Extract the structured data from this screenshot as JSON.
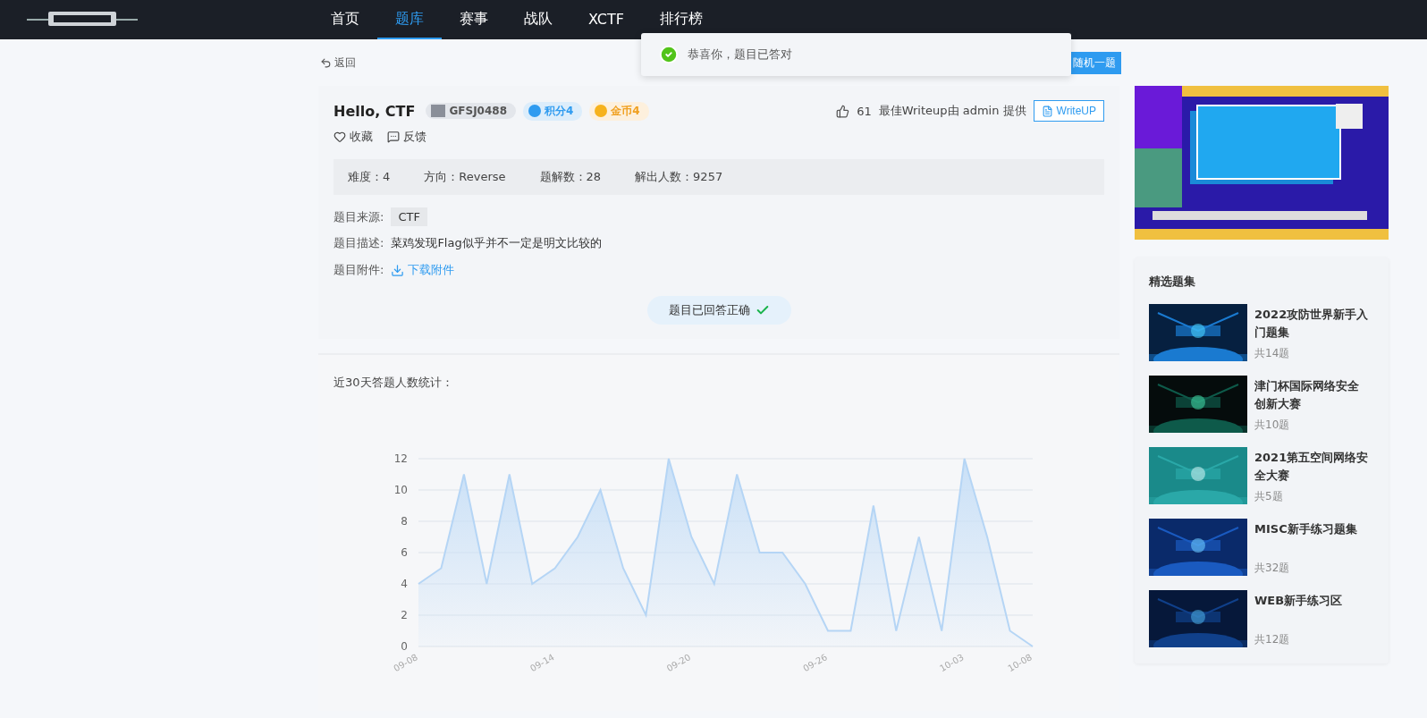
{
  "nav": {
    "items": [
      {
        "label": "首页",
        "selected": false
      },
      {
        "label": "题库",
        "selected": true
      },
      {
        "label": "赛事",
        "selected": false
      },
      {
        "label": "战队",
        "selected": false
      },
      {
        "label": "XCTF",
        "selected": false
      },
      {
        "label": "排行榜",
        "selected": false
      }
    ]
  },
  "toast": {
    "message": "恭喜你，题目已答对"
  },
  "back": "返回",
  "random_button": "随机一题",
  "challenge": {
    "title": "Hello, CTF",
    "code": "GFSJ0488",
    "score": "积分4",
    "coins": "金币4",
    "likes": "61",
    "writeup_note": "最佳Writeup由 admin 提供",
    "writeup_button": "WriteUP",
    "favorite": "收藏",
    "feedback": "反馈",
    "stats": [
      {
        "label": "难度：",
        "value": "4"
      },
      {
        "label": "方向：",
        "value": "Reverse"
      },
      {
        "label": "题解数：",
        "value": "28"
      },
      {
        "label": "解出人数：",
        "value": "9257"
      }
    ],
    "source_label": "题目来源:",
    "source": "CTF",
    "desc_label": "题目描述:",
    "desc": "菜鸡发现Flag似乎并不一定是明文比较的",
    "attach_label": "题目附件:",
    "attach": "下载附件",
    "status": "题目已回答正确"
  },
  "stats_panel": {
    "title": "近30天答题人数统计：",
    "chart_data": {
      "type": "area",
      "categories": [
        "09-08",
        null,
        null,
        null,
        null,
        null,
        "09-14",
        null,
        null,
        null,
        null,
        null,
        "09-20",
        null,
        null,
        null,
        null,
        null,
        "09-26",
        null,
        null,
        null,
        null,
        null,
        "10-03",
        null,
        null,
        "10-08"
      ],
      "series": [
        {
          "color": "#b5d5f5",
          "values": [
            4,
            5,
            11,
            4,
            11,
            4,
            5,
            7,
            10,
            5,
            2,
            12,
            7,
            4,
            11,
            6,
            6,
            4,
            1,
            1,
            9,
            1,
            7,
            1,
            12,
            7,
            1,
            0
          ]
        }
      ],
      "ylim": [
        0,
        12
      ],
      "yticks": [
        0,
        2,
        4,
        6,
        8,
        10,
        12
      ],
      "grid": true
    }
  },
  "sidebar": {
    "title": "精选题集",
    "sets": [
      {
        "name": "2022攻防世界新手入门题集",
        "count": "共14题"
      },
      {
        "name": "津门杯国际网络安全创新大赛",
        "count": "共10题"
      },
      {
        "name": "2021第五空间网络安全大赛",
        "count": "共5题"
      },
      {
        "name": "MISC新手练习题集",
        "count": "共32题"
      },
      {
        "name": "WEB新手练习区",
        "count": "共12题"
      }
    ]
  }
}
